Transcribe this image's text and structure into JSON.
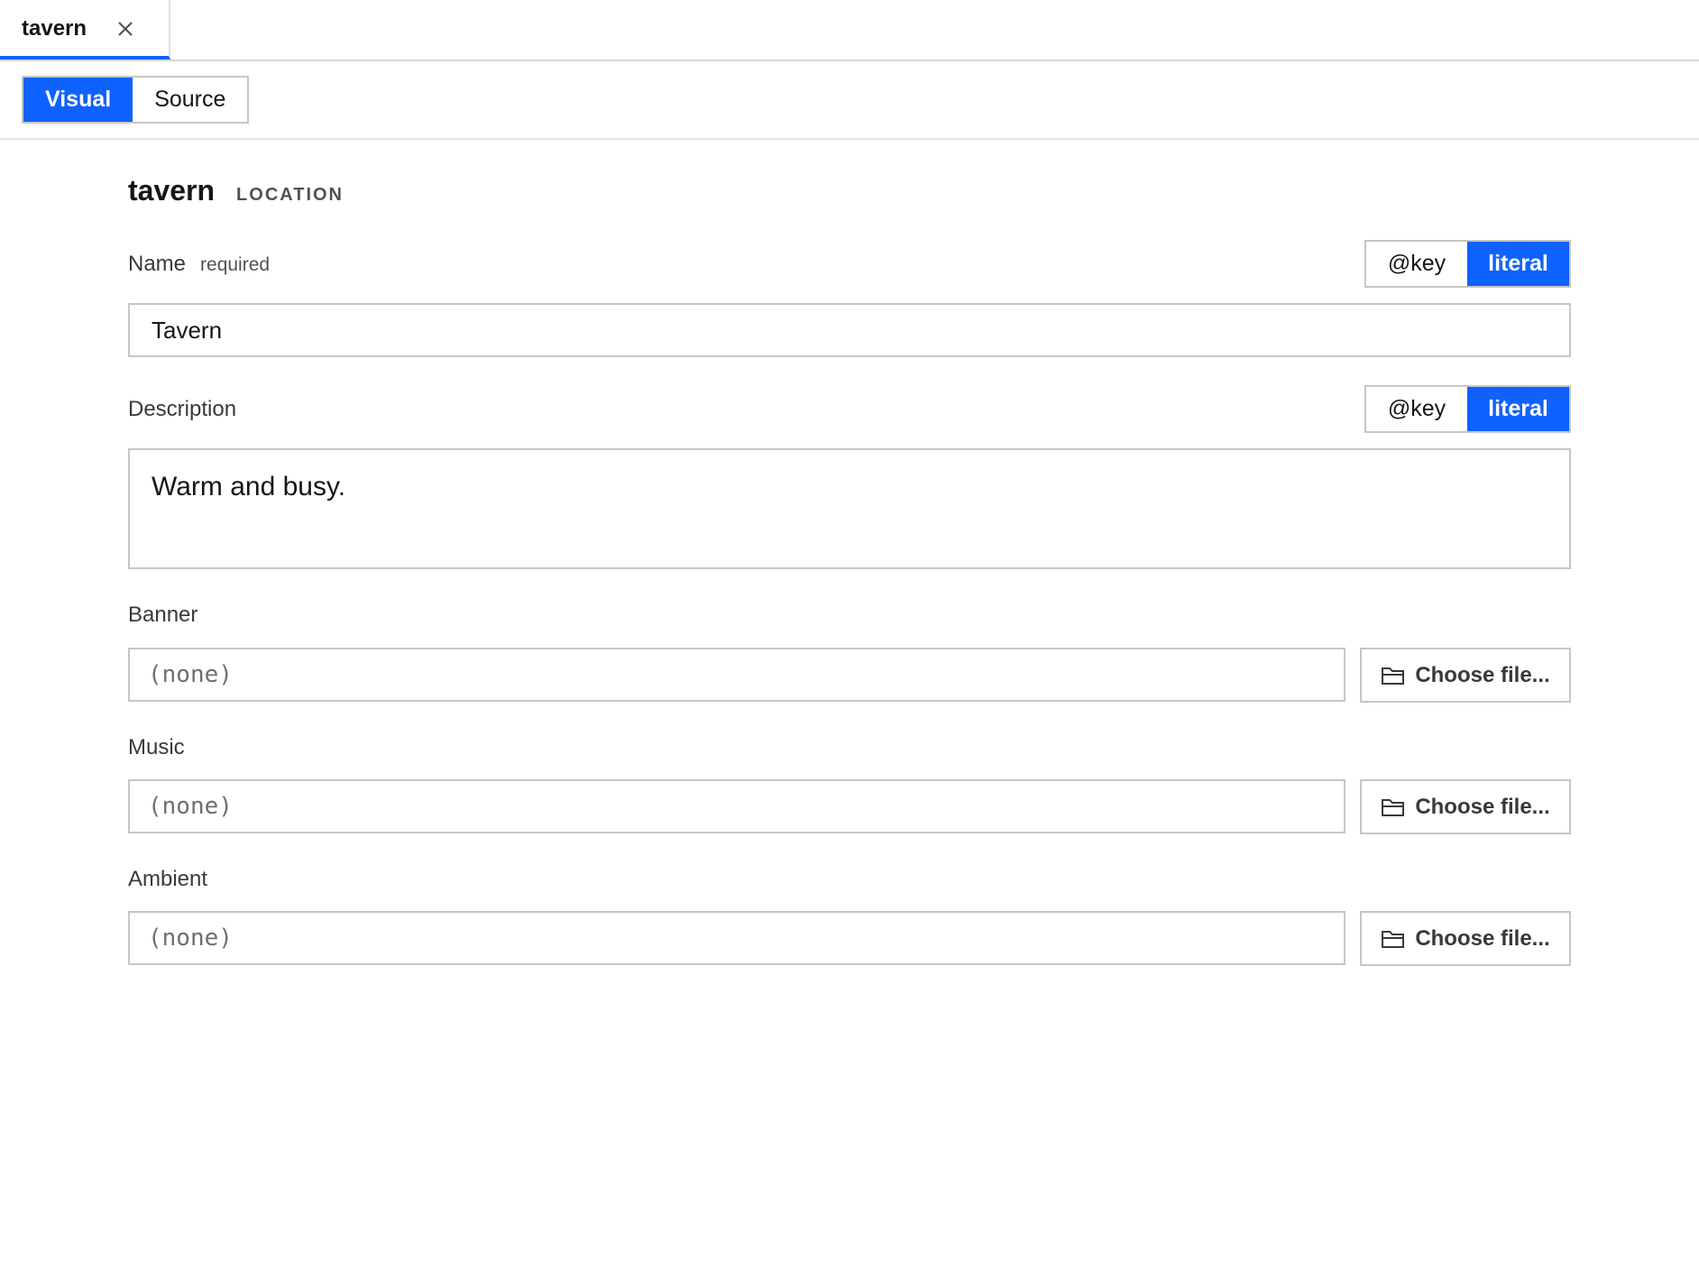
{
  "tabs": [
    {
      "label": "tavern",
      "close_icon": "close-icon",
      "active": true
    }
  ],
  "mode_switch": {
    "visual_label": "Visual",
    "source_label": "Source",
    "selected": "Visual"
  },
  "heading": {
    "title": "tavern",
    "type": "LOCATION"
  },
  "fields": {
    "name": {
      "label": "Name",
      "required_label": "required",
      "value": "Tavern",
      "toggle": {
        "key_label": "@key",
        "literal_label": "literal",
        "selected": "literal"
      }
    },
    "description": {
      "label": "Description",
      "value": "Warm and busy.",
      "toggle": {
        "key_label": "@key",
        "literal_label": "literal",
        "selected": "literal"
      }
    },
    "banner": {
      "label": "Banner",
      "placeholder": "(none)",
      "button_label": "Choose file...",
      "button_icon": "folder-icon"
    },
    "music": {
      "label": "Music",
      "placeholder": "(none)",
      "button_label": "Choose file...",
      "button_icon": "folder-icon"
    },
    "ambient": {
      "label": "Ambient",
      "placeholder": "(none)",
      "button_label": "Choose file...",
      "button_icon": "folder-icon"
    }
  },
  "colors": {
    "accent": "#0f62fe",
    "border": "#c6c6c6",
    "text": "#161616",
    "muted_text": "#525252"
  }
}
